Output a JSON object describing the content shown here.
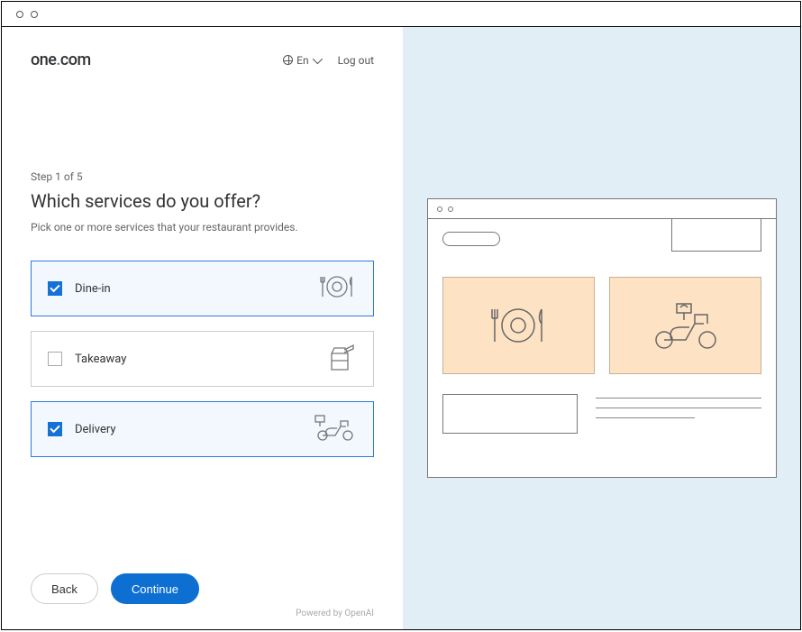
{
  "brand": {
    "part1": "one",
    "dot": ".",
    "part2": "com"
  },
  "header": {
    "language_label": "En",
    "logout_label": "Log out"
  },
  "wizard": {
    "step_label": "Step 1 of 5",
    "heading": "Which services do you offer?",
    "subheading": "Pick one or more services that your restaurant provides."
  },
  "options": [
    {
      "id": "dine-in",
      "label": "Dine-in",
      "checked": true
    },
    {
      "id": "takeaway",
      "label": "Takeaway",
      "checked": false
    },
    {
      "id": "delivery",
      "label": "Delivery",
      "checked": true
    }
  ],
  "buttons": {
    "back": "Back",
    "continue": "Continue"
  },
  "footer": {
    "powered_by": "Powered by OpenAI"
  }
}
